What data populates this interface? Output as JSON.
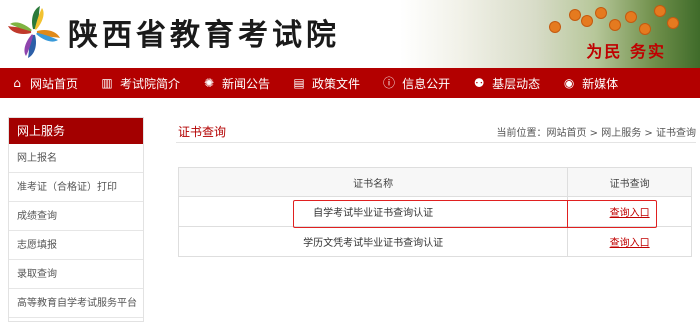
{
  "header": {
    "site_title": "陕西省教育考试院",
    "slogan": "为民 务实"
  },
  "nav": {
    "items": [
      {
        "label": "网站首页",
        "icon": "home-icon"
      },
      {
        "label": "考试院简介",
        "icon": "building-icon"
      },
      {
        "label": "新闻公告",
        "icon": "news-icon"
      },
      {
        "label": "政策文件",
        "icon": "document-icon"
      },
      {
        "label": "信息公开",
        "icon": "info-icon"
      },
      {
        "label": "基层动态",
        "icon": "people-icon"
      },
      {
        "label": "新媒体",
        "icon": "media-icon"
      }
    ]
  },
  "sidebar": {
    "title": "网上服务",
    "items": [
      {
        "label": "网上报名"
      },
      {
        "label": "准考证（合格证）打印"
      },
      {
        "label": "成绩查询"
      },
      {
        "label": "志愿填报"
      },
      {
        "label": "录取查询"
      },
      {
        "label": "高等教育自学考试服务平台"
      }
    ]
  },
  "content": {
    "title": "证书查询",
    "breadcrumb": {
      "prefix": "当前位置：",
      "items": [
        "网站首页",
        "网上服务",
        "证书查询"
      ],
      "separator": " > "
    },
    "table": {
      "headers": [
        "证书名称",
        "证书查询"
      ],
      "rows": [
        {
          "name": "自学考试毕业证书查询认证",
          "action": "查询入口"
        },
        {
          "name": "学历文凭考试毕业证书查询认证",
          "action": "查询入口"
        }
      ]
    }
  },
  "colors": {
    "primary_red": "#b30000",
    "highlight_red": "#e02020",
    "link_red": "#c00000"
  }
}
